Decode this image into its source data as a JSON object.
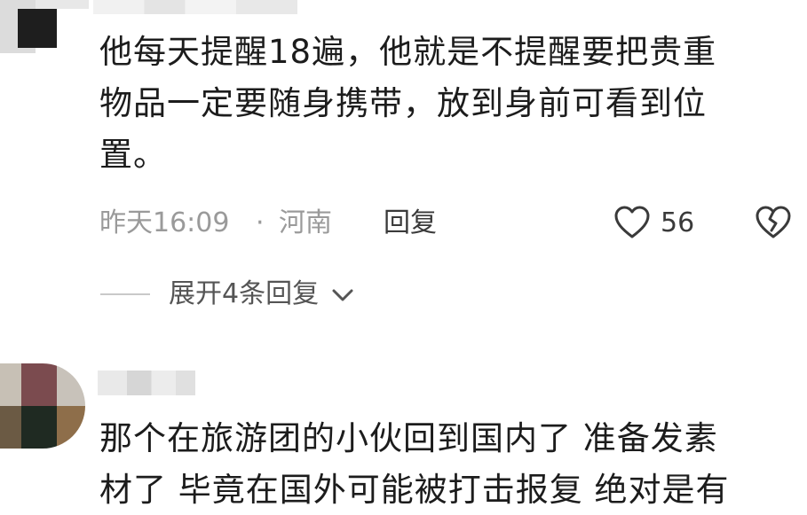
{
  "comments": [
    {
      "lines": [
        "他每天提醒18遍，他就是不提醒要把贵重",
        "物品一定要随身携带，放到身前可看到位",
        "置。"
      ],
      "time": "昨天16:09",
      "separator": "·",
      "location": "河南",
      "reply_label": "回复",
      "likes": "56",
      "expand_label": "展开4条回复"
    },
    {
      "lines": [
        "那个在旅游团的小伙回到国内了 准备发素",
        "材了 毕竟在国外可能被打击报复 绝对是有"
      ]
    }
  ],
  "colors": {
    "text": "#1c1c1c",
    "meta": "#9a9a9a",
    "action": "#3a3a3a"
  },
  "icons": [
    "heart-icon",
    "broken-heart-icon",
    "chevron-down-icon"
  ]
}
